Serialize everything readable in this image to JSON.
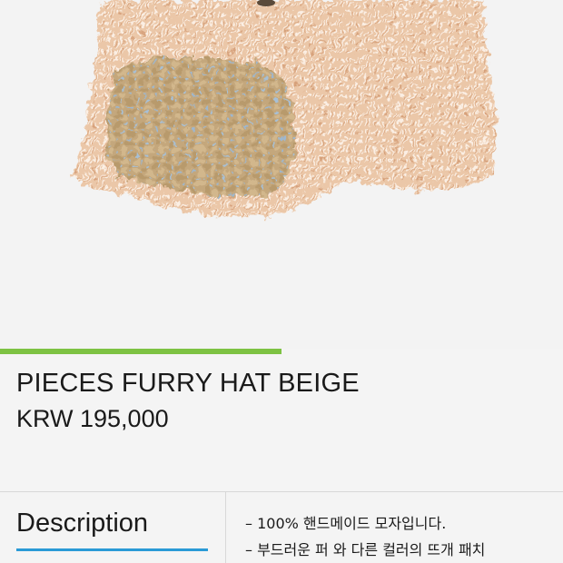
{
  "product": {
    "name": "PIECES FURRY HAT BEIGE",
    "price": "KRW 195,000"
  },
  "gallery": {
    "progress": 0.5
  },
  "description": {
    "tab_label": "Description",
    "lines": [
      "– 100% 핸드메이드 모자입니다.",
      "– 부드러운 퍼 와 다른 컬러의 뜨개 패치"
    ]
  },
  "colors": {
    "accent_green": "#7dc242",
    "accent_blue": "#2a9ad6",
    "hat_beige": "#e9c6a7",
    "patch_tan": "#c8ab80",
    "patch_blue": "#9db7d0"
  }
}
